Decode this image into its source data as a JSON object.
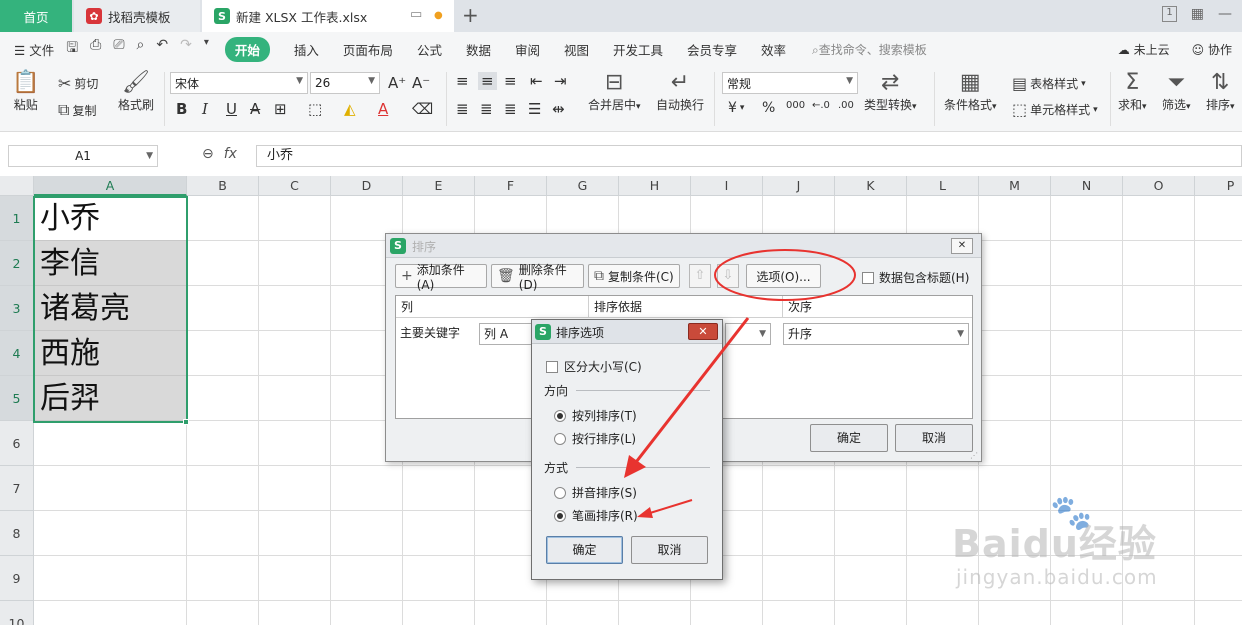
{
  "tabs": {
    "home": "首页",
    "template": "找稻壳模板",
    "file": "新建 XLSX 工作表.xlsx"
  },
  "window": {
    "page_count": "1"
  },
  "menu": {
    "file": "文件",
    "items": [
      "开始",
      "插入",
      "页面布局",
      "公式",
      "数据",
      "审阅",
      "视图",
      "开发工具",
      "会员专享",
      "效率"
    ],
    "search": "查找命令、搜索模板",
    "cloud": "未上云",
    "collab": "协作"
  },
  "ribbon": {
    "paste": "粘贴",
    "cut": "剪切",
    "copy": "复制",
    "format_painter": "格式刷",
    "font_name": "宋体",
    "font_size": "26",
    "merge_center": "合并居中",
    "wrap_text": "自动换行",
    "number_format": "常规",
    "type_convert": "类型转换",
    "conditional_format": "条件格式",
    "table_style": "表格样式",
    "cell_style": "单元格样式",
    "sum": "求和",
    "filter": "筛选",
    "sort": "排序",
    "currency": "¥",
    "percent": "%",
    "thousands": "000"
  },
  "formula": {
    "cell_ref": "A1",
    "content": "小乔"
  },
  "grid": {
    "columns": [
      "A",
      "B",
      "C",
      "D",
      "E",
      "F",
      "G",
      "H",
      "I",
      "J",
      "K",
      "L",
      "M",
      "N",
      "O",
      "P"
    ],
    "rows": [
      "1",
      "2",
      "3",
      "4",
      "5",
      "6",
      "7",
      "8",
      "9",
      "10"
    ],
    "cells_a": [
      "小乔",
      "李信",
      "诸葛亮",
      "西施",
      "后羿"
    ]
  },
  "sort_dialog": {
    "title": "排序",
    "add_condition": "添加条件(A)",
    "delete_condition": "删除条件(D)",
    "copy_condition": "复制条件(C)",
    "options": "选项(O)...",
    "has_header": "数据包含标题(H)",
    "col_header": "列",
    "basis_header": "排序依据",
    "order_header": "次序",
    "primary_key": "主要关键字",
    "column_value": "列 A",
    "order_value": "升序",
    "ok": "确定",
    "cancel": "取消"
  },
  "options_dialog": {
    "title": "排序选项",
    "case_sensitive": "区分大小写(C)",
    "direction": "方向",
    "by_column": "按列排序(T)",
    "by_row": "按行排序(L)",
    "method": "方式",
    "pinyin": "拼音排序(S)",
    "stroke": "笔画排序(R)",
    "ok": "确定",
    "cancel": "取消",
    "selected_direction": "by_column",
    "selected_method": "stroke"
  },
  "colors": {
    "accent": "#34b37d",
    "annotation": "#e8332f",
    "selection": "#2f9e6c"
  },
  "watermark": {
    "brand": "Baidu经验",
    "url": "jingyan.baidu.com"
  }
}
